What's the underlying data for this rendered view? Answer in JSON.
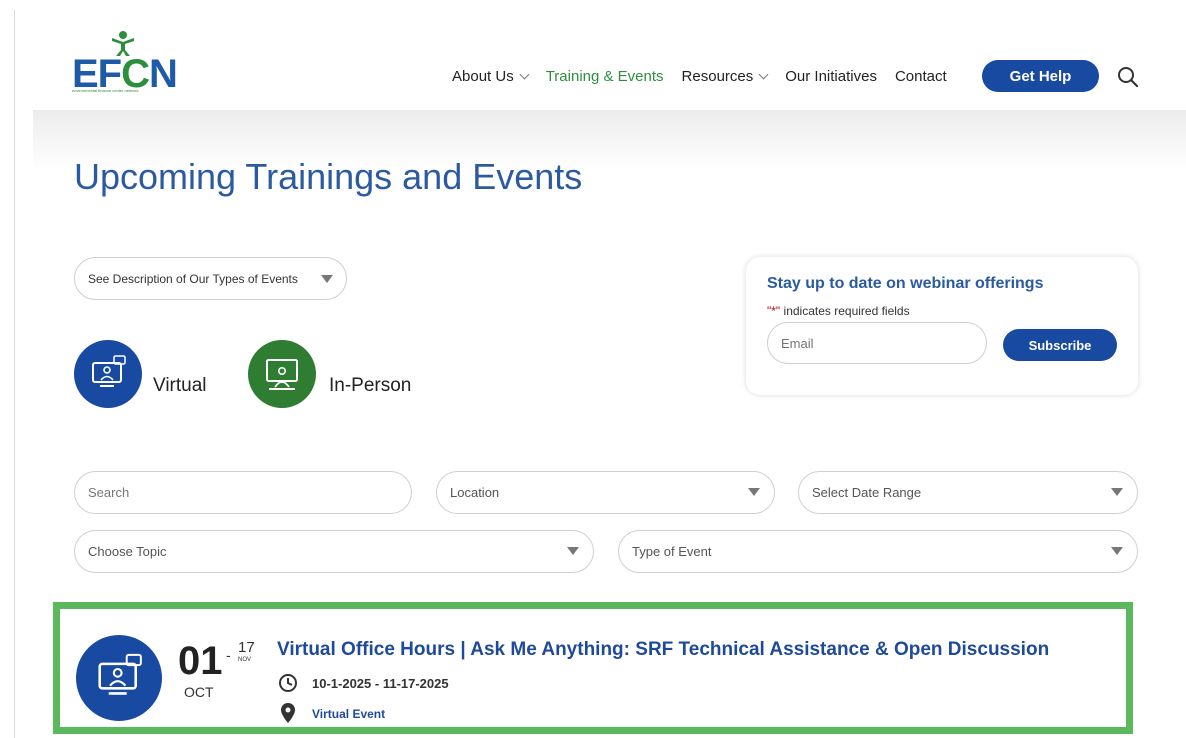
{
  "header": {
    "logo_text_1": "EF",
    "logo_text_2": "C",
    "logo_text_3": "N",
    "logo_tagline": "environmental finance center network",
    "nav": [
      {
        "label": "About Us",
        "has_dropdown": true,
        "active": false
      },
      {
        "label": "Training & Events",
        "has_dropdown": false,
        "active": true
      },
      {
        "label": "Resources",
        "has_dropdown": true,
        "active": false
      },
      {
        "label": "Our Initiatives",
        "has_dropdown": false,
        "active": false
      },
      {
        "label": "Contact",
        "has_dropdown": false,
        "active": false
      }
    ],
    "cta_label": "Get Help"
  },
  "page": {
    "title": "Upcoming Trainings and Events",
    "description_dropdown": "See Description of Our Types of Events",
    "types": [
      {
        "label": "Virtual",
        "color": "#174aa0",
        "icon": "virtual-meeting-icon"
      },
      {
        "label": "In-Person",
        "color": "#2e7d32",
        "icon": "presentation-icon"
      }
    ]
  },
  "subscribe": {
    "title": "Stay up to date on webinar offerings",
    "required_star": "\"*\"",
    "required_note": " indicates required fields",
    "email_placeholder": "Email",
    "button_label": "Subscribe"
  },
  "filters": {
    "search_placeholder": "Search",
    "location": "Location",
    "date_range": "Select Date Range",
    "topic": "Choose Topic",
    "event_type": "Type of Event"
  },
  "events": [
    {
      "start_day": "01",
      "start_month": "OCT",
      "end_day": "17",
      "end_month": "NOV",
      "title": "Virtual Office Hours | Ask Me Anything: SRF Technical Assistance & Open Discussion",
      "dates": "10-1-2025 - 11-17-2025",
      "location": "Virtual Event",
      "highlight_color": "#5cb85c"
    }
  ],
  "colors": {
    "brand_blue": "#174aa0",
    "brand_green": "#2d8f3e",
    "title_blue": "#2c5aa0"
  }
}
